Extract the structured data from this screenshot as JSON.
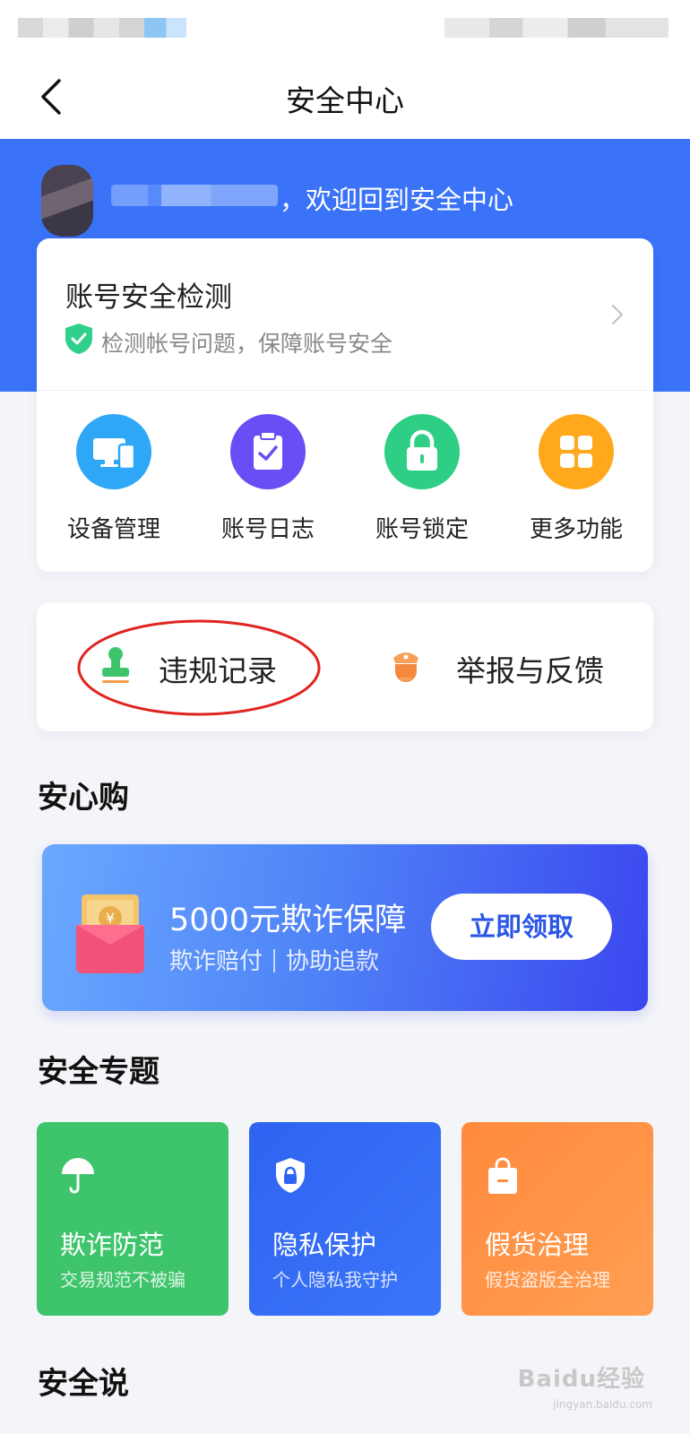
{
  "nav": {
    "title": "安全中心"
  },
  "hero": {
    "welcome": "，欢迎回到安全中心"
  },
  "account_check": {
    "title": "账号安全检测",
    "subtitle": "检测帐号问题，保障账号安全"
  },
  "features": [
    {
      "label": "设备管理",
      "icon": "devices-icon",
      "color": "#2fa7f7"
    },
    {
      "label": "账号日志",
      "icon": "clipboard-icon",
      "color": "#6a4df5"
    },
    {
      "label": "账号锁定",
      "icon": "lock-icon",
      "color": "#2ecf85"
    },
    {
      "label": "更多功能",
      "icon": "grid-icon",
      "color": "#ffa81c"
    }
  ],
  "quick": {
    "violation": "违规记录",
    "report": "举报与反馈"
  },
  "sections": {
    "shop": "安心购",
    "topics": "安全专题",
    "talk": "安全说"
  },
  "banner": {
    "title": "5000元欺诈保障",
    "sub1": "欺诈赔付",
    "sub2": "协助追款",
    "button": "立即领取"
  },
  "topics": [
    {
      "title": "欺诈防范",
      "subtitle": "交易规范不被骗",
      "icon": "umbrella-icon"
    },
    {
      "title": "隐私保护",
      "subtitle": "个人隐私我守护",
      "icon": "shield-lock-icon"
    },
    {
      "title": "假货治理",
      "subtitle": "假货盗版全治理",
      "icon": "bag-icon"
    }
  ],
  "watermark": {
    "main": "Baidu经验",
    "url": "jingyan.baidu.com"
  }
}
